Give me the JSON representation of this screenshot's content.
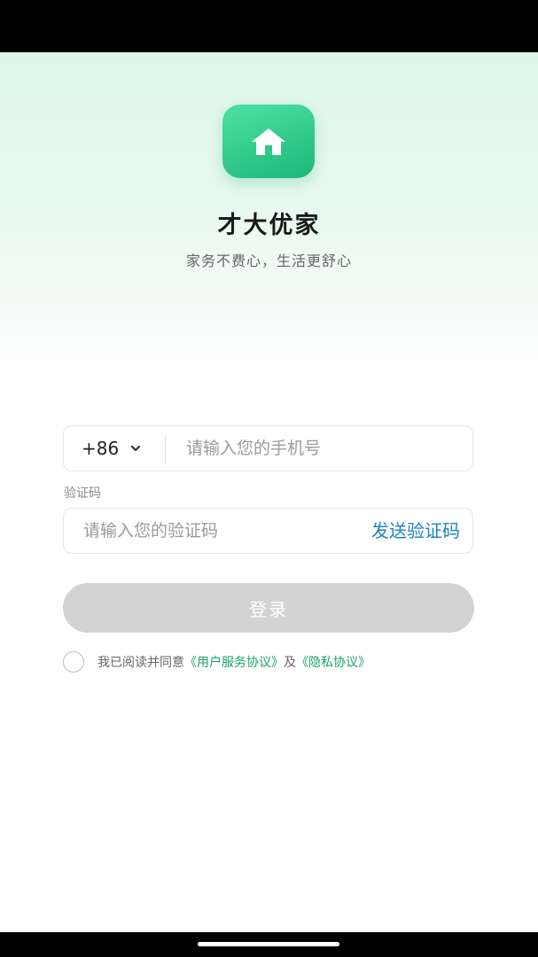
{
  "app": {
    "name": "才大优家",
    "slogan": "家务不费心，生活更舒心"
  },
  "login_form": {
    "country_code": "+86",
    "phone_placeholder": "请输入您的手机号",
    "code_label": "验证码",
    "code_placeholder": "请输入您的验证码",
    "send_code_label": "发送验证码",
    "login_label": "登录"
  },
  "agreement": {
    "prefix": "我已阅读并同意",
    "user_agreement_link": "《用户服务协议》",
    "conjunction": "及",
    "privacy_link": "《隐私协议》",
    "checked": false
  },
  "icons": {
    "app_icon": "home-icon",
    "country_dropdown": "chevron-down-icon"
  },
  "colors": {
    "brand_green": "#2fc989",
    "link_blue": "#1a82c4",
    "link_green": "#1aa36b",
    "button_disabled": "#d3d3d3"
  }
}
